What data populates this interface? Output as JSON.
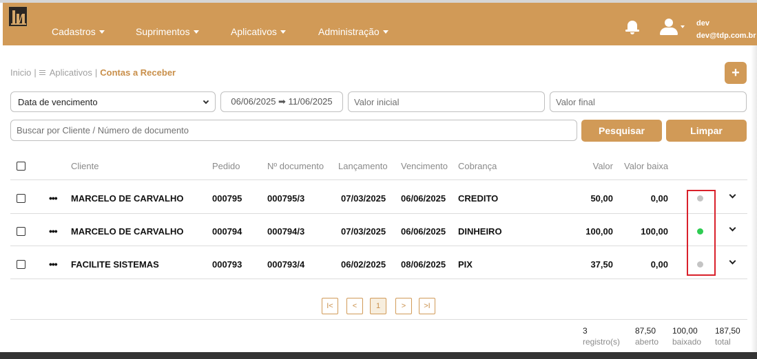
{
  "nav": {
    "menus": [
      {
        "label": "Cadastros"
      },
      {
        "label": "Suprimentos"
      },
      {
        "label": "Aplicativos"
      },
      {
        "label": "Administração"
      }
    ],
    "user_name": "dev",
    "user_email": "dev@tdp.com.br"
  },
  "breadcrumb": {
    "home": "Inicio",
    "sep": "|",
    "apps": "Aplicativos",
    "current": "Contas a Receber"
  },
  "filters": {
    "date_type": "Data de vencimento",
    "date_range": "06/06/2025 ➡ 11/06/2025",
    "valor_inicial_placeholder": "Valor inicial",
    "valor_final_placeholder": "Valor final",
    "search_placeholder": "Buscar por Cliente / Número de documento",
    "search_label": "Pesquisar",
    "clear_label": "Limpar",
    "add_label": "+"
  },
  "table": {
    "headers": {
      "cliente": "Cliente",
      "pedido": "Pedido",
      "documento": "Nº documento",
      "lancamento": "Lançamento",
      "vencimento": "Vencimento",
      "cobranca": "Cobrança",
      "valor": "Valor",
      "valor_baixa": "Valor baixa"
    },
    "rows": [
      {
        "actions": "•••",
        "cliente": "MARCELO DE CARVALHO",
        "pedido": "000795",
        "documento": "000795/3",
        "lancamento": "07/03/2025",
        "vencimento": "06/06/2025",
        "cobranca": "CREDITO",
        "valor": "50,00",
        "valor_baixa": "0,00",
        "status_color": "#c4c4c4"
      },
      {
        "actions": "•••",
        "cliente": "MARCELO DE CARVALHO",
        "pedido": "000794",
        "documento": "000794/3",
        "lancamento": "07/03/2025",
        "vencimento": "06/06/2025",
        "cobranca": "DINHEIRO",
        "valor": "100,00",
        "valor_baixa": "100,00",
        "status_color": "#2ecc52"
      },
      {
        "actions": "•••",
        "cliente": "FACILITE SISTEMAS",
        "pedido": "000793",
        "documento": "000793/4",
        "lancamento": "06/02/2025",
        "vencimento": "08/06/2025",
        "cobranca": "PIX",
        "valor": "37,50",
        "valor_baixa": "0,00",
        "status_color": "#c4c4c4"
      }
    ]
  },
  "pagination": {
    "first": "I<",
    "prev": "<",
    "page": "1",
    "next": ">",
    "last": ">I"
  },
  "summary": {
    "registros_value": "3",
    "registros_label": "registro(s)",
    "aberto_value": "87,50",
    "aberto_label": "aberto",
    "baixado_value": "100,00",
    "baixado_label": "baixado",
    "total_value": "187,50",
    "total_label": "total"
  },
  "colors": {
    "accent": "#d19a57",
    "highlight": "#d9202a"
  }
}
